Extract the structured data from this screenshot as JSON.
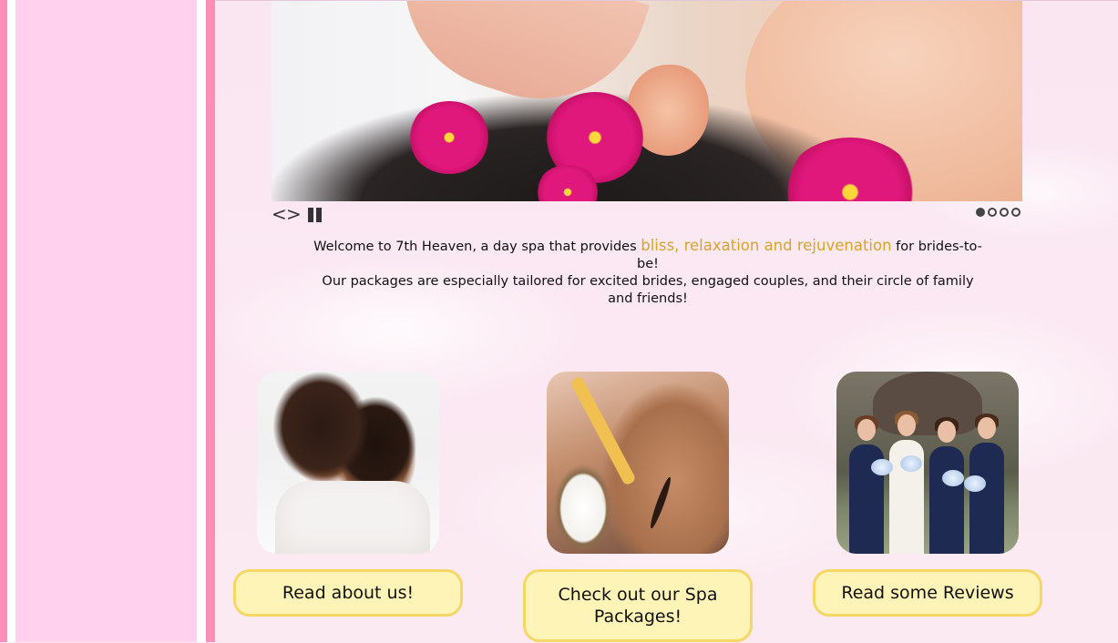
{
  "slider": {
    "prev_label": "<",
    "next_label": ">",
    "slide_count": 4,
    "active_slide": 1
  },
  "intro": {
    "text_before": "Welcome to 7th Heaven, a day spa that provides ",
    "highlight": "bliss, relaxation and rejuvenation",
    "text_after": " for brides-to-be!",
    "line2": "Our packages are especially tailored for excited brides, engaged couples, and their circle of family and friends!"
  },
  "cards": [
    {
      "button_label": "Read about us!"
    },
    {
      "button_label": "Check out our Spa Packages!"
    },
    {
      "button_label": "Read some Reviews"
    }
  ],
  "colors": {
    "sidebar": "#ffd1ef",
    "stripe": "#ff8fb7",
    "button_fill": "#fff4b8",
    "button_border": "#f5d766",
    "highlight_text": "#d6a52a"
  },
  "icons": {
    "prev": "chevron-left-icon",
    "next": "chevron-right-icon",
    "pause": "pause-icon"
  }
}
